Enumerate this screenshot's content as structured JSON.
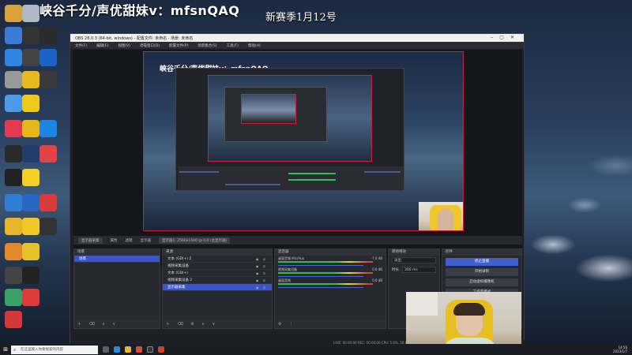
{
  "overlay": {
    "title": "峡谷千分/声优甜妹v：mfsnQAQ",
    "season": "新赛季1月12号"
  },
  "obs": {
    "window_title": "OBS 28.0.3 (64-bit, windows) - 配置文件: 未命名 - 场景: 未命名",
    "menu": [
      "文件(F)",
      "编辑(E)",
      "视图(V)",
      "停靠窗口(D)",
      "配置文件(P)",
      "场景集合(S)",
      "工具(T)",
      "帮助(H)"
    ],
    "scene_bar": {
      "source_label": "显示器采集",
      "properties_label": "属性",
      "filters_label": "滤镜",
      "display_label": "显示器",
      "display_value": "显示器1: 2560x1440 @ 0,0 (主显示器)"
    },
    "scenes": {
      "header": "场景",
      "items": [
        "场景"
      ]
    },
    "sources": {
      "header": "来源",
      "items": [
        "文本 (GDI+) 2",
        "视频采集设备",
        "文本 (GDI+)",
        "视频采集设备 2",
        "显示器采集"
      ],
      "selected_index": 4
    },
    "mixer": {
      "header": "混音器",
      "channels": [
        {
          "name": "桌面音频 Mic/Aux",
          "value": "-7.0 dB"
        },
        {
          "name": "视频采集设备",
          "value": "0.0 dB"
        },
        {
          "name": "桌面音频",
          "value": "0.0 dB"
        }
      ]
    },
    "transitions": {
      "header": "转场特效",
      "type": "淡出",
      "duration_label": "时长",
      "duration": "300 ms"
    },
    "controls": {
      "header": "控件",
      "buttons": [
        "停止直播",
        "开始录制",
        "启动虚拟摄像机",
        "工作室模式"
      ]
    },
    "status": "LIVE: 00:00:00  REC: 00:00:00  CPU: 5.6%, 30.00 fps"
  },
  "taskbar": {
    "search_placeholder": "在这里输入你要搜索的内容",
    "time": "14:56",
    "date": "2023/1/7"
  }
}
